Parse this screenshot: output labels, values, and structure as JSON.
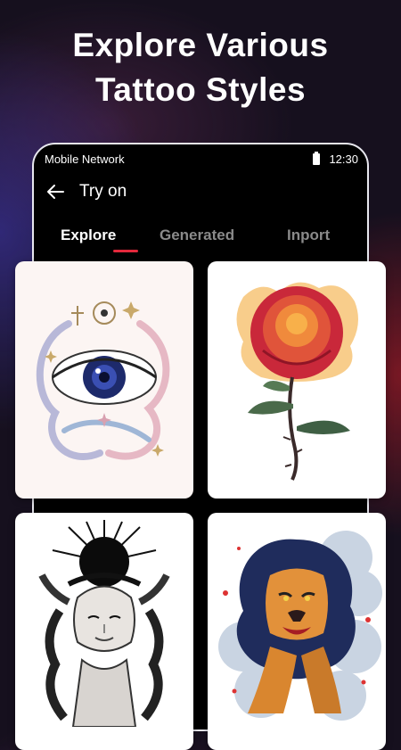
{
  "headline": {
    "line1": "Explore Various",
    "line2": "Tattoo Styles"
  },
  "status_bar": {
    "network": "Mobile Network",
    "time": "12:30",
    "battery_icon": "battery-icon"
  },
  "app_bar": {
    "back_icon": "arrow-left-icon",
    "title": "Try on"
  },
  "tabs": [
    {
      "label": "Explore",
      "active": true
    },
    {
      "label": "Generated",
      "active": false
    },
    {
      "label": "Inport",
      "active": false
    }
  ],
  "gallery": [
    {
      "subject": "eye-tattoo-design"
    },
    {
      "subject": "rose-tattoo-design"
    },
    {
      "subject": "medusa-tattoo-design"
    },
    {
      "subject": "lion-tattoo-design"
    }
  ],
  "colors": {
    "accent": "#e3283b",
    "phone_bg": "#000000",
    "tab_inactive": "#8a8a8a"
  }
}
